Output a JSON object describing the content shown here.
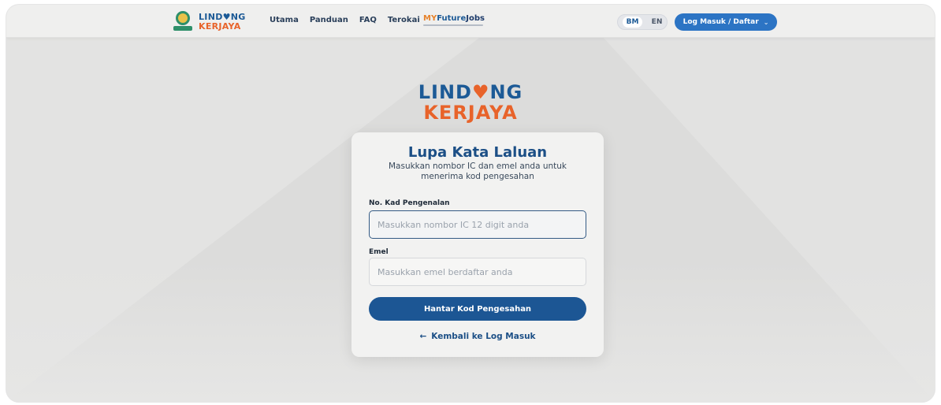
{
  "brand": {
    "word_top": "LIND♥NG",
    "word_bottom": "KERJAYA"
  },
  "nav": {
    "items": [
      "Utama",
      "Panduan",
      "FAQ",
      "Terokai"
    ]
  },
  "partner": {
    "part1": "MY",
    "part2": "Future",
    "part3": "Jobs"
  },
  "lang": {
    "bm": "BM",
    "en": "EN",
    "active": "BM"
  },
  "header": {
    "login_label": "Log Masuk / Daftar",
    "chevron": "⌄"
  },
  "main_logo": {
    "top_left": "LIND",
    "heart": "♥",
    "top_right": "NG",
    "bottom": "KERJAYA"
  },
  "card": {
    "title": "Lupa Kata Laluan",
    "subtitle": "Masukkan nombor IC dan emel anda untuk menerima kod pengesahan",
    "ic_label": "No. Kad Pengenalan",
    "ic_placeholder": "Masukkan nombor IC 12 digit anda",
    "email_label": "Emel",
    "email_placeholder": "Masukkan emel berdaftar anda",
    "submit_label": "Hantar Kod Pengesahan",
    "back_arrow": "←",
    "back_label": "Kembali ke Log Masuk"
  },
  "colors": {
    "primary": "#1c5694",
    "accent": "#e8632a",
    "nav_button": "#2c74c4"
  }
}
